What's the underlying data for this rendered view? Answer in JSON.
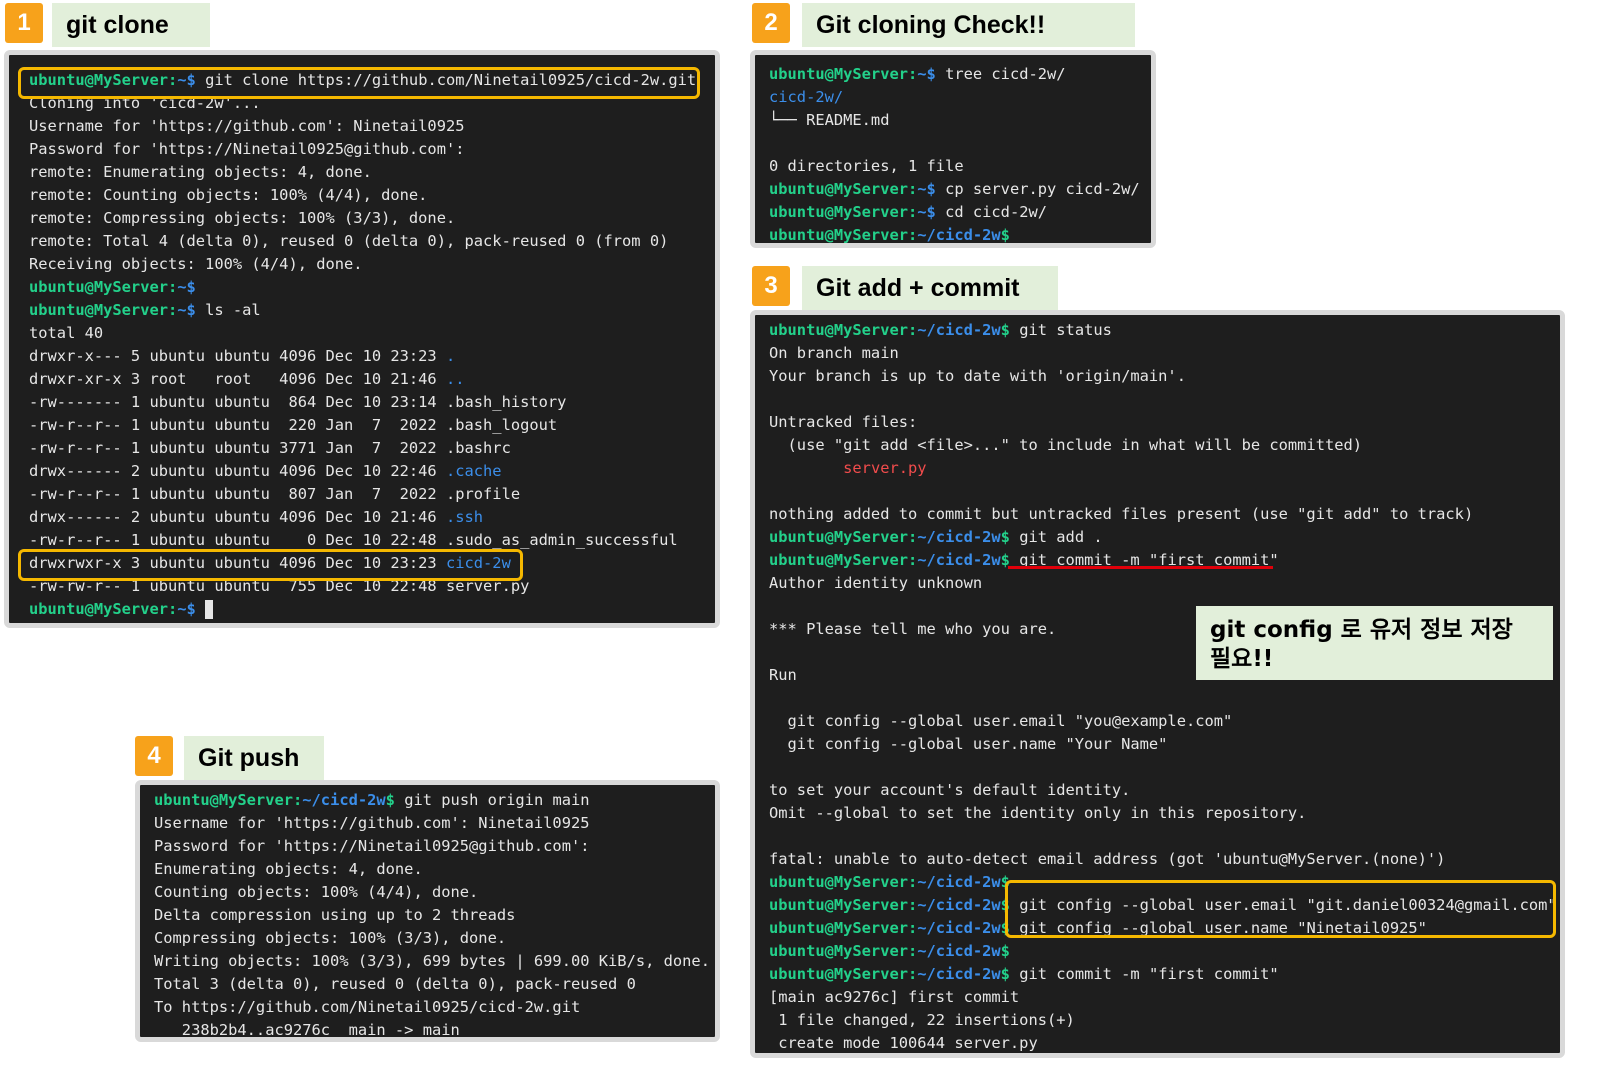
{
  "steps": [
    {
      "number": "1",
      "title": "git clone"
    },
    {
      "number": "2",
      "title": "Git cloning Check!!"
    },
    {
      "number": "3",
      "title": "Git add + commit"
    },
    {
      "number": "4",
      "title": "Git push"
    }
  ],
  "prompt_base": "ubuntu@MyServer:",
  "terminal1": {
    "lines": [
      [
        {
          "t": "ubuntu@MyServer:",
          "c": "p"
        },
        {
          "t": "~$",
          "c": "pp"
        },
        {
          "t": " git clone https://github.com/Ninetail0925/cicd-2w.git"
        }
      ],
      [
        {
          "t": "Cloning into 'cicd-2w'..."
        }
      ],
      [
        {
          "t": "Username for 'https://github.com': Ninetail0925"
        }
      ],
      [
        {
          "t": "Password for 'https://Ninetail0925@github.com':"
        }
      ],
      [
        {
          "t": "remote: Enumerating objects: 4, done."
        }
      ],
      [
        {
          "t": "remote: Counting objects: 100% (4/4), done."
        }
      ],
      [
        {
          "t": "remote: Compressing objects: 100% (3/3), done."
        }
      ],
      [
        {
          "t": "remote: Total 4 (delta 0), reused 0 (delta 0), pack-reused 0 (from 0)"
        }
      ],
      [
        {
          "t": "Receiving objects: 100% (4/4), done."
        }
      ],
      [
        {
          "t": "ubuntu@MyServer:",
          "c": "p"
        },
        {
          "t": "~$",
          "c": "pp"
        }
      ],
      [
        {
          "t": "ubuntu@MyServer:",
          "c": "p"
        },
        {
          "t": "~$",
          "c": "pp"
        },
        {
          "t": " ls -al"
        }
      ],
      [
        {
          "t": "total 40"
        }
      ],
      [
        {
          "t": "drwxr-x--- 5 ubuntu ubuntu 4096 Dec 10 23:23 "
        },
        {
          "t": ".",
          "c": "d"
        }
      ],
      [
        {
          "t": "drwxr-xr-x 3 root   root   4096 Dec 10 21:46 "
        },
        {
          "t": "..",
          "c": "d"
        }
      ],
      [
        {
          "t": "-rw------- 1 ubuntu ubuntu  864 Dec 10 23:14 .bash_history"
        }
      ],
      [
        {
          "t": "-rw-r--r-- 1 ubuntu ubuntu  220 Jan  7  2022 .bash_logout"
        }
      ],
      [
        {
          "t": "-rw-r--r-- 1 ubuntu ubuntu 3771 Jan  7  2022 .bashrc"
        }
      ],
      [
        {
          "t": "drwx------ 2 ubuntu ubuntu 4096 Dec 10 22:46 "
        },
        {
          "t": ".cache",
          "c": "d"
        }
      ],
      [
        {
          "t": "-rw-r--r-- 1 ubuntu ubuntu  807 Jan  7  2022 .profile"
        }
      ],
      [
        {
          "t": "drwx------ 2 ubuntu ubuntu 4096 Dec 10 21:46 "
        },
        {
          "t": ".ssh",
          "c": "d"
        }
      ],
      [
        {
          "t": "-rw-r--r-- 1 ubuntu ubuntu    0 Dec 10 22:48 .sudo_as_admin_successful"
        }
      ],
      [
        {
          "t": "drwxrwxr-x 3 ubuntu ubuntu 4096 Dec 10 23:23 "
        },
        {
          "t": "cicd-2w",
          "c": "d"
        }
      ],
      [
        {
          "t": "-rw-rw-r-- 1 ubuntu ubuntu  755 Dec 10 22:48 server.py"
        }
      ],
      [
        {
          "t": "ubuntu@MyServer:",
          "c": "p"
        },
        {
          "t": "~$",
          "c": "pp"
        },
        {
          "t": " "
        },
        {
          "t": "",
          "c": "cursor"
        }
      ]
    ]
  },
  "terminal2": {
    "lines": [
      [
        {
          "t": "ubuntu@MyServer:",
          "c": "p"
        },
        {
          "t": "~$",
          "c": "pp"
        },
        {
          "t": " tree cicd-2w/"
        }
      ],
      [
        {
          "t": "cicd-2w/",
          "c": "d"
        }
      ],
      [
        {
          "t": "└── README.md"
        }
      ],
      [
        {
          "t": ""
        }
      ],
      [
        {
          "t": "0 directories, 1 file"
        }
      ],
      [
        {
          "t": "ubuntu@MyServer:",
          "c": "p"
        },
        {
          "t": "~$",
          "c": "pp"
        },
        {
          "t": " cp server.py cicd-2w/"
        }
      ],
      [
        {
          "t": "ubuntu@MyServer:",
          "c": "p"
        },
        {
          "t": "~$",
          "c": "pp"
        },
        {
          "t": " cd cicd-2w/"
        }
      ],
      [
        {
          "t": "ubuntu@MyServer:",
          "c": "p"
        },
        {
          "t": "~/cicd-2w",
          "c": "pp"
        },
        {
          "t": "$",
          "c": "p"
        }
      ]
    ]
  },
  "terminal3": {
    "lines": [
      [
        {
          "t": "ubuntu@MyServer:",
          "c": "p"
        },
        {
          "t": "~/cicd-2w",
          "c": "pp"
        },
        {
          "t": "$",
          "c": "p"
        },
        {
          "t": " git status"
        }
      ],
      [
        {
          "t": "On branch main"
        }
      ],
      [
        {
          "t": "Your branch is up to date with 'origin/main'."
        }
      ],
      [
        {
          "t": ""
        }
      ],
      [
        {
          "t": "Untracked files:"
        }
      ],
      [
        {
          "t": "  (use \"git add <file>...\" to include in what will be committed)"
        }
      ],
      [
        {
          "t": "        "
        },
        {
          "t": "server.py",
          "c": "r"
        }
      ],
      [
        {
          "t": ""
        }
      ],
      [
        {
          "t": "nothing added to commit but untracked files present (use \"git add\" to track)"
        }
      ],
      [
        {
          "t": "ubuntu@MyServer:",
          "c": "p"
        },
        {
          "t": "~/cicd-2w",
          "c": "pp"
        },
        {
          "t": "$",
          "c": "p"
        },
        {
          "t": " git add ."
        }
      ],
      [
        {
          "t": "ubuntu@MyServer:",
          "c": "p"
        },
        {
          "t": "~/cicd-2w",
          "c": "pp"
        },
        {
          "t": "$",
          "c": "p"
        },
        {
          "t": " git commit -m \"first commit\""
        }
      ],
      [
        {
          "t": "Author identity unknown"
        }
      ],
      [
        {
          "t": ""
        }
      ],
      [
        {
          "t": "*** Please tell me who you are."
        }
      ],
      [
        {
          "t": ""
        }
      ],
      [
        {
          "t": "Run"
        }
      ],
      [
        {
          "t": ""
        }
      ],
      [
        {
          "t": "  git config --global user.email \"you@example.com\""
        }
      ],
      [
        {
          "t": "  git config --global user.name \"Your Name\""
        }
      ],
      [
        {
          "t": ""
        }
      ],
      [
        {
          "t": "to set your account's default identity."
        }
      ],
      [
        {
          "t": "Omit --global to set the identity only in this repository."
        }
      ],
      [
        {
          "t": ""
        }
      ],
      [
        {
          "t": "fatal: unable to auto-detect email address (got 'ubuntu@MyServer.(none)')"
        }
      ],
      [
        {
          "t": "ubuntu@MyServer:",
          "c": "p"
        },
        {
          "t": "~/cicd-2w",
          "c": "pp"
        },
        {
          "t": "$",
          "c": "p"
        }
      ],
      [
        {
          "t": "ubuntu@MyServer:",
          "c": "p"
        },
        {
          "t": "~/cicd-2w",
          "c": "pp"
        },
        {
          "t": "$",
          "c": "p"
        },
        {
          "t": " git config --global user.email \"git.daniel00324@gmail.com\""
        }
      ],
      [
        {
          "t": "ubuntu@MyServer:",
          "c": "p"
        },
        {
          "t": "~/cicd-2w",
          "c": "pp"
        },
        {
          "t": "$",
          "c": "p"
        },
        {
          "t": " git config --global user.name \"Ninetail0925\""
        }
      ],
      [
        {
          "t": "ubuntu@MyServer:",
          "c": "p"
        },
        {
          "t": "~/cicd-2w",
          "c": "pp"
        },
        {
          "t": "$",
          "c": "p"
        }
      ],
      [
        {
          "t": "ubuntu@MyServer:",
          "c": "p"
        },
        {
          "t": "~/cicd-2w",
          "c": "pp"
        },
        {
          "t": "$",
          "c": "p"
        },
        {
          "t": " git commit -m \"first commit\""
        }
      ],
      [
        {
          "t": "[main ac9276c] first commit"
        }
      ],
      [
        {
          "t": " 1 file changed, 22 insertions(+)"
        }
      ],
      [
        {
          "t": " create mode 100644 server.py"
        }
      ]
    ]
  },
  "terminal4": {
    "lines": [
      [
        {
          "t": "ubuntu@MyServer:",
          "c": "p"
        },
        {
          "t": "~/cicd-2w",
          "c": "pp"
        },
        {
          "t": "$",
          "c": "p"
        },
        {
          "t": " git push origin main"
        }
      ],
      [
        {
          "t": "Username for 'https://github.com': Ninetail0925"
        }
      ],
      [
        {
          "t": "Password for 'https://Ninetail0925@github.com':"
        }
      ],
      [
        {
          "t": "Enumerating objects: 4, done."
        }
      ],
      [
        {
          "t": "Counting objects: 100% (4/4), done."
        }
      ],
      [
        {
          "t": "Delta compression using up to 2 threads"
        }
      ],
      [
        {
          "t": "Compressing objects: 100% (3/3), done."
        }
      ],
      [
        {
          "t": "Writing objects: 100% (3/3), 699 bytes | 699.00 KiB/s, done."
        }
      ],
      [
        {
          "t": "Total 3 (delta 0), reused 0 (delta 0), pack-reused 0"
        }
      ],
      [
        {
          "t": "To https://github.com/Ninetail0925/cicd-2w.git"
        }
      ],
      [
        {
          "t": "   238b2b4..ac9276c  main -> main"
        }
      ]
    ]
  },
  "callout": {
    "line1": "git config 로 유저 정보 저장",
    "line2": "필요!!"
  },
  "colors": {
    "badge": "#f7a21b",
    "title_bg": "#e2efda",
    "terminal_bg": "#1e1e1e",
    "prompt_green": "#23d18b",
    "path_blue": "#3b8eea",
    "untracked_red": "#f14c4c",
    "highlight_yellow": "#f5b800",
    "underline_red": "#e0000a"
  }
}
